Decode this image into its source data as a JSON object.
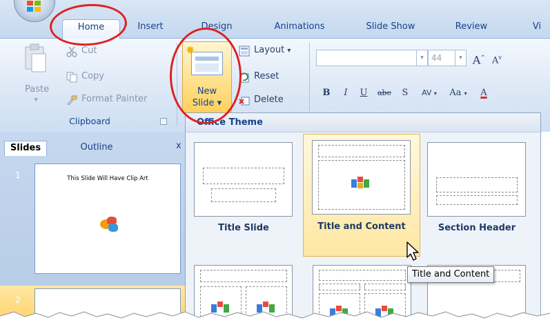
{
  "tabs": [
    {
      "label": "Home",
      "active": true
    },
    {
      "label": "Insert"
    },
    {
      "label": "Design"
    },
    {
      "label": "Animations"
    },
    {
      "label": "Slide Show"
    },
    {
      "label": "Review"
    },
    {
      "label": "Vi"
    }
  ],
  "clipboard": {
    "paste": "Paste",
    "cut": "Cut",
    "copy": "Copy",
    "format_painter": "Format Painter",
    "group_title": "Clipboard"
  },
  "slides_group": {
    "new_slide_line1": "New",
    "new_slide_line2": "Slide",
    "new_slide_arrow": "▾",
    "layout": "Layout",
    "layout_arrow": "▾",
    "reset": "Reset",
    "delete": "Delete"
  },
  "font_group": {
    "font_size": "44",
    "grow": "A",
    "shrink": "A",
    "bold": "B",
    "italic": "I",
    "underline": "U",
    "strike": "abe",
    "shadow": "S",
    "spacing": "AV",
    "change_case": "Aa",
    "font_color": "A"
  },
  "slides_pane": {
    "tabs": [
      "Slides",
      "Outline"
    ],
    "close": "x",
    "slide1_number": "1",
    "slide1_title": "This Slide Will Have Clip Art",
    "slide2_number": "2"
  },
  "gallery": {
    "header": "Office Theme",
    "layouts": [
      {
        "label": "Title Slide"
      },
      {
        "label": "Title and Content",
        "hovered": true
      },
      {
        "label": "Section Header"
      }
    ]
  },
  "tooltip": "Title and Content",
  "colors": {
    "ribbon_text": "#15428b",
    "hover_fill": "#ffe49a",
    "annotation_red": "#e02020"
  }
}
